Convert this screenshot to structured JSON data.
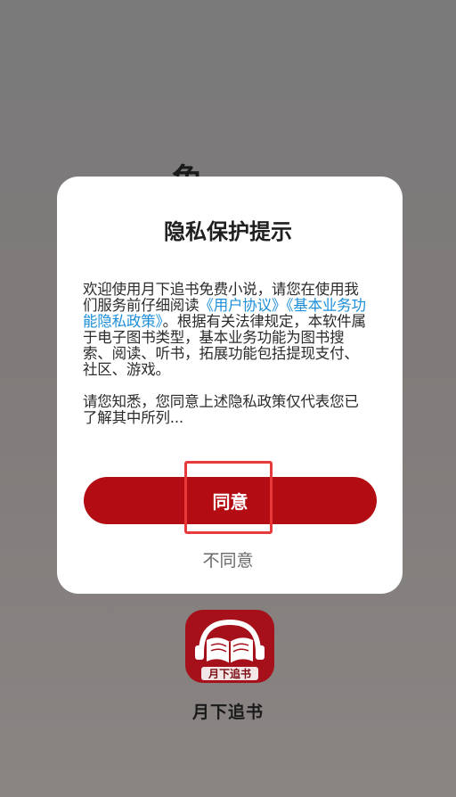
{
  "background": {
    "partial_text": "免"
  },
  "dialog": {
    "title": "隐私保护提示",
    "body_pre": "欢迎使用月下追书免费小说，请您在使用我们服务前仔细阅读",
    "link_user_agreement": "《用户协议》",
    "link_privacy_policy": "《基本业务功能隐私政策》",
    "body_post": "。根据有关法律规定，本软件属于电子图书类型，基本业务功能为图书搜索、阅读、听书，拓展功能包括提现支付、社区、游戏。",
    "body_second": "请您知悉，您同意上述隐私政策仅代表您已了解其中所列...",
    "agree_label": "同意",
    "disagree_label": "不同意"
  },
  "app": {
    "icon_text": "月下追书",
    "name": "月下追书"
  },
  "colors": {
    "accent": "#b30c12",
    "link": "#1d8fd8",
    "highlight": "#e8393b"
  }
}
